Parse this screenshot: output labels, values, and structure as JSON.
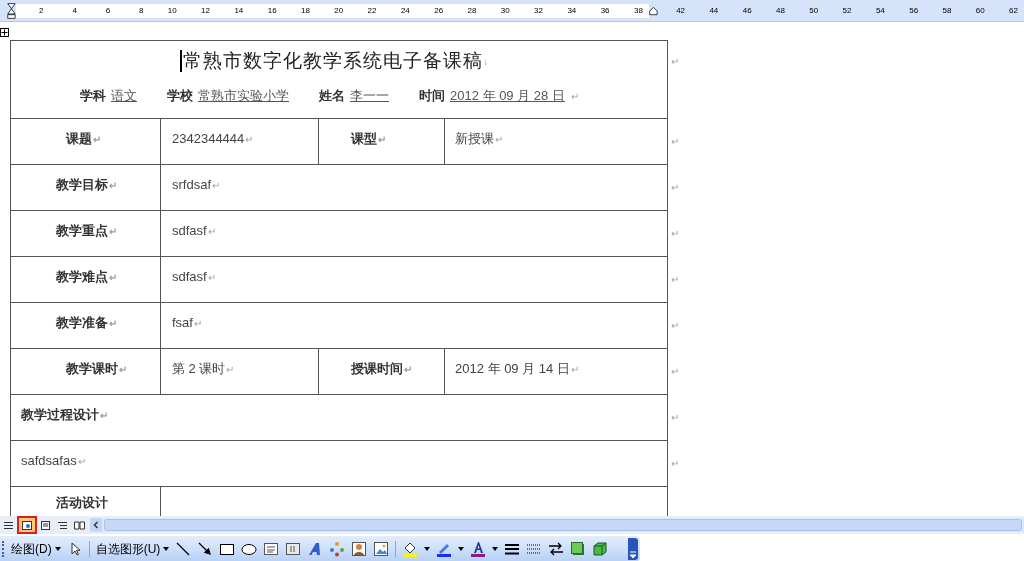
{
  "ruler": {
    "left_labels": [
      "2",
      "4",
      "6",
      "8",
      "10",
      "12",
      "14",
      "16",
      "18",
      "20",
      "22",
      "24",
      "26",
      "28",
      "30",
      "32",
      "34",
      "36",
      "38"
    ],
    "right_labels": [
      "42",
      "44",
      "46",
      "48",
      "50",
      "52",
      "54",
      "56",
      "58",
      "60",
      "62"
    ]
  },
  "document": {
    "title": "常熟市数字化教学系统电子备课稿",
    "title_mark": "↓",
    "end_mark": "↵",
    "info": [
      {
        "label": "学科",
        "value": "语文"
      },
      {
        "label": "学校",
        "value": "常熟市实验小学"
      },
      {
        "label": "姓名",
        "value": "李一一"
      },
      {
        "label": "时间",
        "value": "2012 年 09 月 28 日"
      }
    ],
    "rows": [
      {
        "kind": "four",
        "cells": [
          "课题",
          "2342344444",
          "课型",
          "新授课"
        ]
      },
      {
        "kind": "two",
        "cells": [
          "教学目标",
          "srfdsaf"
        ]
      },
      {
        "kind": "two",
        "cells": [
          "教学重点",
          "sdfasf"
        ]
      },
      {
        "kind": "two",
        "cells": [
          "教学难点",
          "sdfasf"
        ]
      },
      {
        "kind": "two",
        "cells": [
          "教学准备",
          "fsaf"
        ]
      },
      {
        "kind": "four",
        "cells": [
          "教学课时",
          "第 2 课时",
          "授课时间",
          "2012 年 09 月 14 日"
        ]
      },
      {
        "kind": "heading",
        "cells": [
          "教学过程设计"
        ]
      },
      {
        "kind": "plain",
        "cells": [
          "safdsafas"
        ]
      },
      {
        "kind": "cut",
        "cells": [
          "活动设计"
        ]
      }
    ]
  },
  "view_buttons": [
    {
      "kind": "normal",
      "selected": false
    },
    {
      "kind": "web",
      "selected": true
    },
    {
      "kind": "print",
      "selected": false
    },
    {
      "kind": "outline",
      "selected": false
    },
    {
      "kind": "reading",
      "selected": false
    }
  ],
  "drawing_toolbar": {
    "draw_menu": "绘图(D)",
    "autoshapes_menu": "自选图形(U)"
  }
}
